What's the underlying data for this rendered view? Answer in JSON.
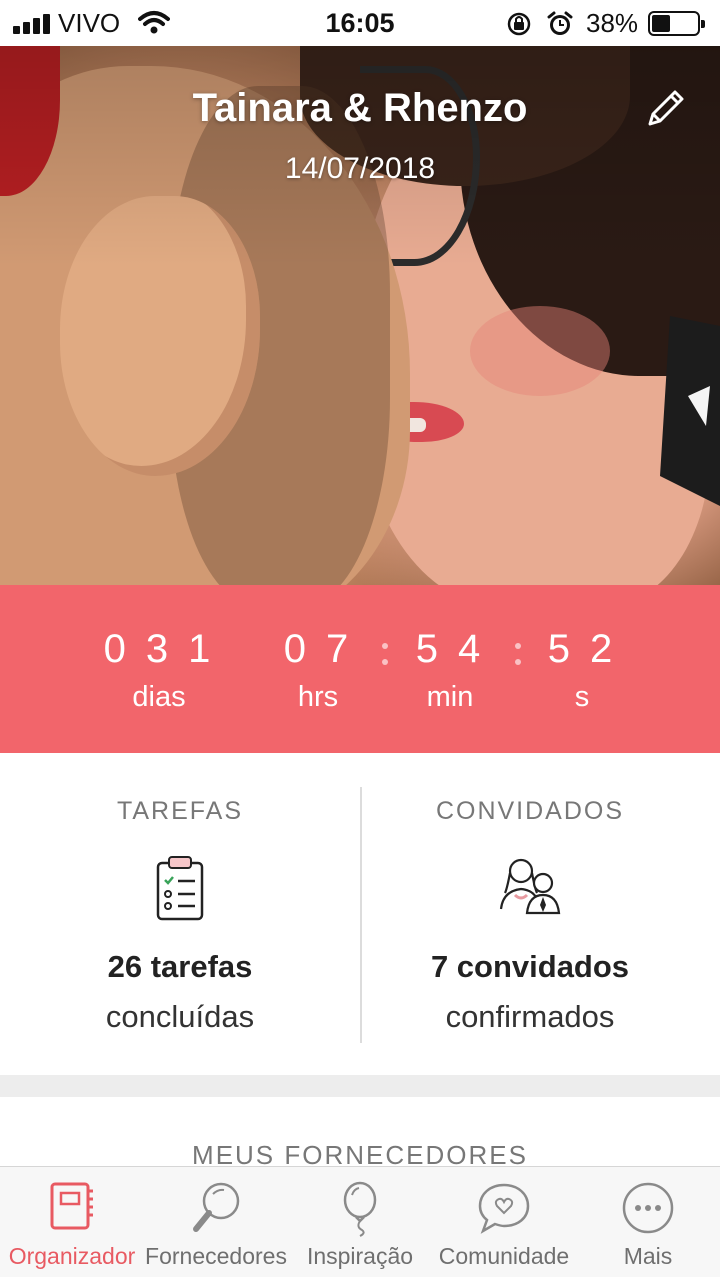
{
  "status_bar": {
    "carrier": "VIVO",
    "time": "16:05",
    "battery": "38%",
    "battery_level": 0.38,
    "icons": [
      "signal-icon",
      "wifi-icon",
      "orientation-lock-icon",
      "alarm-icon",
      "battery-icon"
    ]
  },
  "hero": {
    "couple_name": "Tainara & Rhenzo",
    "date": "14/07/2018",
    "edit_icon": "pencil-icon"
  },
  "countdown": {
    "days": "031",
    "hours": "07",
    "minutes": "54",
    "seconds": "52",
    "days_label": "dias",
    "hours_label": "hrs",
    "minutes_label": "min",
    "seconds_label": "s",
    "background": "#f2656b"
  },
  "stats": {
    "tasks": {
      "title": "TAREFAS",
      "count": "26 tarefas",
      "subtitle": "concluídas",
      "icon": "clipboard-checklist-icon"
    },
    "guests": {
      "title": "CONVIDADOS",
      "count": "7 convidados",
      "subtitle": "confirmados",
      "icon": "guests-couple-icon"
    }
  },
  "suppliers": {
    "title": "MEUS FORNECEDORES"
  },
  "tab_bar": {
    "accent": "#e85a62",
    "items": [
      {
        "label": "Organizador",
        "icon": "planner-book-icon",
        "active": true
      },
      {
        "label": "Fornecedores",
        "icon": "magnifier-icon",
        "active": false
      },
      {
        "label": "Inspiração",
        "icon": "balloon-icon",
        "active": false
      },
      {
        "label": "Comunidade",
        "icon": "chat-heart-icon",
        "active": false
      },
      {
        "label": "Mais",
        "icon": "more-dots-icon",
        "active": false
      }
    ]
  }
}
